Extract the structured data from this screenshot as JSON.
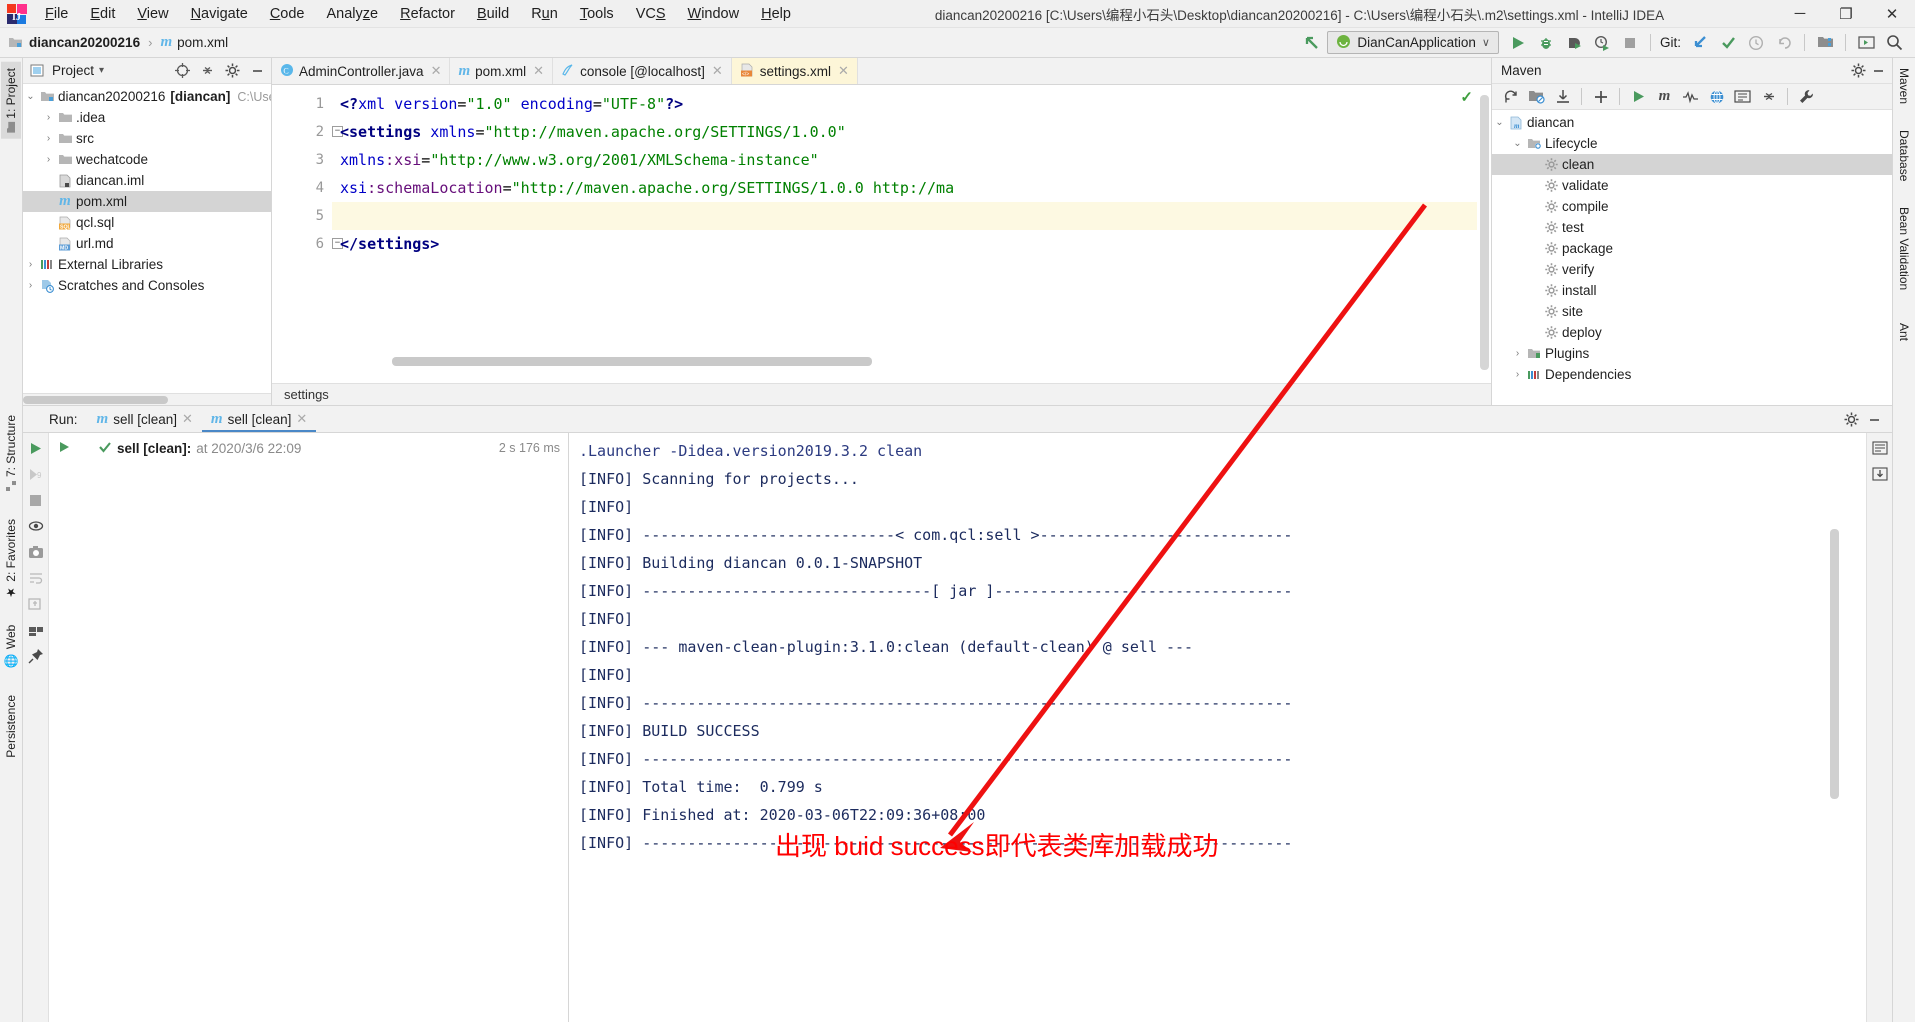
{
  "window": {
    "title": "diancan20200216 [C:\\Users\\编程小石头\\Desktop\\diancan20200216] - C:\\Users\\编程小石头\\.m2\\settings.xml - IntelliJ IDEA",
    "minimize_label": "─",
    "maximize_label": "❐",
    "close_label": "✕",
    "app_icon": "intellij-idea-logo"
  },
  "menubar": {
    "items": [
      {
        "label": "File"
      },
      {
        "label": "Edit"
      },
      {
        "label": "View"
      },
      {
        "label": "Navigate"
      },
      {
        "label": "Code"
      },
      {
        "label": "Analyze"
      },
      {
        "label": "Refactor"
      },
      {
        "label": "Build"
      },
      {
        "label": "Run"
      },
      {
        "label": "Tools"
      },
      {
        "label": "VCS"
      },
      {
        "label": "Window"
      },
      {
        "label": "Help"
      }
    ]
  },
  "navbar": {
    "breadcrumb": {
      "project": "diancan20200216",
      "separator": "›",
      "file": "pom.xml",
      "file_icon": "maven-m-icon",
      "project_icon": "module-folder-icon"
    },
    "run_config": {
      "name": "DianCanApplication",
      "icon": "spring-boot-icon",
      "chevron": "∨"
    },
    "back_arrow_icon": "back-arrow-icon",
    "buttons": [
      {
        "name": "run-button",
        "icon": "play-icon"
      },
      {
        "name": "debug-button",
        "icon": "bug-icon"
      },
      {
        "name": "run-coverage-button",
        "icon": "coverage-icon"
      },
      {
        "name": "profile-button",
        "icon": "profiler-icon"
      },
      {
        "name": "stop-button",
        "icon": "stop-square-icon"
      }
    ],
    "git_label": "Git:",
    "git_buttons": [
      {
        "name": "update-project-button",
        "icon": "update-arrow-icon"
      },
      {
        "name": "commit-button",
        "icon": "check-icon"
      },
      {
        "name": "history-button",
        "icon": "clock-icon"
      },
      {
        "name": "rollback-button",
        "icon": "undo-icon"
      }
    ],
    "right_buttons": [
      {
        "name": "project-structure-button",
        "icon": "project-structure-icon"
      },
      {
        "name": "select-in-button",
        "icon": "terminal-window-icon"
      },
      {
        "name": "search-everywhere-button",
        "icon": "search-icon"
      }
    ]
  },
  "left_strip": {
    "tabs": [
      {
        "label": "1: Project",
        "icon": "project-icon",
        "selected": true
      },
      {
        "label": "7: Structure",
        "icon": "structure-icon",
        "selected": false
      },
      {
        "label": "2: Favorites",
        "icon": "star-icon",
        "selected": false
      },
      {
        "label": "Web",
        "icon": "web-globe-icon",
        "selected": false
      },
      {
        "label": "Persistence",
        "icon": "persistence-icon",
        "selected": false
      }
    ]
  },
  "right_strip": {
    "tabs": [
      {
        "label": "Maven",
        "icon": "maven-icon"
      },
      {
        "label": "Database",
        "icon": "database-icon"
      },
      {
        "label": "Bean Validation",
        "icon": "bean-icon"
      },
      {
        "label": "Ant",
        "icon": "ant-icon"
      }
    ]
  },
  "project_panel": {
    "title": "Project",
    "title_chevron": "▾",
    "view_icon": "project-view-icon",
    "toolbar": [
      {
        "name": "locate-button",
        "icon": "crosshair-icon"
      },
      {
        "name": "collapse-all-button",
        "icon": "collapse-all-icon"
      },
      {
        "name": "settings-button",
        "icon": "gear-icon"
      },
      {
        "name": "hide-button",
        "icon": "minimize-icon"
      }
    ],
    "tree": [
      {
        "indent": 0,
        "twist": "⌄",
        "icon": "module-folder-icon",
        "label": "diancan20200216",
        "bold_label": "[diancan]",
        "path": "C:\\Use",
        "selected": false
      },
      {
        "indent": 1,
        "twist": "›",
        "icon": "folder-icon",
        "label": ".idea",
        "selected": false
      },
      {
        "indent": 1,
        "twist": "›",
        "icon": "folder-icon",
        "label": "src",
        "selected": false
      },
      {
        "indent": 1,
        "twist": "›",
        "icon": "folder-icon",
        "label": "wechatcode",
        "selected": false
      },
      {
        "indent": 1,
        "twist": "",
        "icon": "iml-file-icon",
        "label": "diancan.iml",
        "selected": false
      },
      {
        "indent": 1,
        "twist": "",
        "icon": "maven-m-icon",
        "label": "pom.xml",
        "selected": true
      },
      {
        "indent": 1,
        "twist": "",
        "icon": "sql-file-icon",
        "label": "qcl.sql",
        "selected": false
      },
      {
        "indent": 1,
        "twist": "",
        "icon": "md-file-icon",
        "label": "url.md",
        "selected": false
      },
      {
        "indent": 0,
        "twist": "›",
        "icon": "libraries-icon",
        "label": "External Libraries",
        "selected": false
      },
      {
        "indent": 0,
        "twist": "›",
        "icon": "scratches-icon",
        "label": "Scratches and Consoles",
        "selected": false
      }
    ]
  },
  "editor": {
    "tabs": [
      {
        "label": "AdminController.java",
        "icon": "java-class-icon",
        "active": false,
        "close": "✕"
      },
      {
        "label": "pom.xml",
        "icon": "maven-m-icon",
        "active": false,
        "close": "✕"
      },
      {
        "label": "console [@localhost]",
        "icon": "console-icon",
        "active": false,
        "close": "✕"
      },
      {
        "label": "settings.xml",
        "icon": "xml-file-icon",
        "active": true,
        "close": "✕"
      }
    ],
    "line_numbers": [
      "1",
      "2",
      "3",
      "4",
      "5",
      "6"
    ],
    "lines": [
      {
        "n": "1",
        "fold": "",
        "highlight": false,
        "tokens": [
          {
            "t": "<?",
            "c": "tk-tag"
          },
          {
            "t": "xml",
            "c": "tk-attr"
          },
          {
            "t": " version",
            "c": "tk-attr"
          },
          {
            "t": "=",
            "c": "tk-punc"
          },
          {
            "t": "\"1.0\"",
            "c": "tk-val"
          },
          {
            "t": " encoding",
            "c": "tk-attr"
          },
          {
            "t": "=",
            "c": "tk-punc"
          },
          {
            "t": "\"UTF-8\"",
            "c": "tk-val"
          },
          {
            "t": "?>",
            "c": "tk-tag"
          }
        ]
      },
      {
        "n": "2",
        "fold": "−",
        "highlight": false,
        "tokens": [
          {
            "t": "<settings",
            "c": "tk-tag"
          },
          {
            "t": " xmlns",
            "c": "tk-attr"
          },
          {
            "t": "=",
            "c": "tk-punc"
          },
          {
            "t": "\"http://maven.apache.org/SETTINGS/1.0.0\"",
            "c": "tk-val"
          }
        ]
      },
      {
        "n": "3",
        "fold": "",
        "highlight": false,
        "tokens": [
          {
            "t": "          xmlns",
            "c": "tk-attr"
          },
          {
            "t": ":xsi",
            "c": "tk-attr2"
          },
          {
            "t": "=",
            "c": "tk-punc"
          },
          {
            "t": "\"http://www.w3.org/2001/XMLSchema-instance\"",
            "c": "tk-val"
          }
        ]
      },
      {
        "n": "4",
        "fold": "",
        "highlight": false,
        "tokens": [
          {
            "t": "          xsi",
            "c": "tk-attr"
          },
          {
            "t": ":schemaLocation",
            "c": "tk-attr2"
          },
          {
            "t": "=",
            "c": "tk-punc"
          },
          {
            "t": "\"http://maven.apache.org/SETTINGS/1.0.0 http://ma",
            "c": "tk-val"
          }
        ]
      },
      {
        "n": "5",
        "fold": "",
        "highlight": true,
        "tokens": []
      },
      {
        "n": "6",
        "fold": "−",
        "highlight": false,
        "tokens": [
          {
            "t": "</settings>",
            "c": "tk-tag"
          }
        ]
      }
    ],
    "inspection_ok_icon": "inspection-check-icon",
    "breadcrumb": "settings"
  },
  "maven_panel": {
    "title": "Maven",
    "header_buttons": [
      {
        "name": "maven-settings-button",
        "icon": "gear-icon"
      },
      {
        "name": "maven-hide-button",
        "icon": "minimize-icon"
      }
    ],
    "toolbar": [
      {
        "name": "reimport-button",
        "icon": "refresh-icon"
      },
      {
        "name": "generate-sources-button",
        "icon": "generate-sources-icon"
      },
      {
        "name": "download-sources-button",
        "icon": "download-icon"
      },
      {
        "name": "add-maven-project-button",
        "icon": "plus-icon"
      },
      {
        "name": "run-maven-build-button",
        "icon": "play-icon"
      },
      {
        "name": "execute-maven-goal-button",
        "icon": "maven-m-icon"
      },
      {
        "name": "toggle-skip-tests-button",
        "icon": "skip-tests-icon"
      },
      {
        "name": "toggle-offline-button",
        "icon": "offline-icon"
      },
      {
        "name": "show-dependencies-button",
        "icon": "dependencies-diagram-icon"
      },
      {
        "name": "collapse-all-button",
        "icon": "collapse-all-icon"
      },
      {
        "name": "maven-settings-wrench-button",
        "icon": "wrench-icon"
      }
    ],
    "tree": [
      {
        "indent": 0,
        "twist": "⌄",
        "icon": "maven-project-icon",
        "label": "diancan",
        "selected": false
      },
      {
        "indent": 1,
        "twist": "⌄",
        "icon": "lifecycle-folder-icon",
        "label": "Lifecycle",
        "selected": false
      },
      {
        "indent": 2,
        "twist": "",
        "icon": "goal-gear-icon",
        "label": "clean",
        "selected": true
      },
      {
        "indent": 2,
        "twist": "",
        "icon": "goal-gear-icon",
        "label": "validate",
        "selected": false
      },
      {
        "indent": 2,
        "twist": "",
        "icon": "goal-gear-icon",
        "label": "compile",
        "selected": false
      },
      {
        "indent": 2,
        "twist": "",
        "icon": "goal-gear-icon",
        "label": "test",
        "selected": false
      },
      {
        "indent": 2,
        "twist": "",
        "icon": "goal-gear-icon",
        "label": "package",
        "selected": false
      },
      {
        "indent": 2,
        "twist": "",
        "icon": "goal-gear-icon",
        "label": "verify",
        "selected": false
      },
      {
        "indent": 2,
        "twist": "",
        "icon": "goal-gear-icon",
        "label": "install",
        "selected": false
      },
      {
        "indent": 2,
        "twist": "",
        "icon": "goal-gear-icon",
        "label": "site",
        "selected": false
      },
      {
        "indent": 2,
        "twist": "",
        "icon": "goal-gear-icon",
        "label": "deploy",
        "selected": false
      },
      {
        "indent": 1,
        "twist": "›",
        "icon": "plugins-folder-icon",
        "label": "Plugins",
        "selected": false
      },
      {
        "indent": 1,
        "twist": "›",
        "icon": "dependencies-folder-icon",
        "label": "Dependencies",
        "selected": false
      }
    ]
  },
  "run_panel": {
    "label": "Run:",
    "tabs": [
      {
        "label": "sell [clean]",
        "icon": "maven-m-icon",
        "active": false,
        "close": "✕"
      },
      {
        "label": "sell [clean]",
        "icon": "maven-m-icon",
        "active": true,
        "close": "✕"
      }
    ],
    "header_buttons": [
      {
        "name": "run-settings-button",
        "icon": "gear-icon"
      },
      {
        "name": "run-hide-button",
        "icon": "minimize-icon"
      }
    ],
    "sidebar_buttons": [
      {
        "name": "rerun-button",
        "icon": "play-icon"
      },
      {
        "name": "rerun-failed-tests-button",
        "icon": "rerun-failed-icon"
      },
      {
        "name": "stop-button",
        "icon": "stop-square-icon"
      },
      {
        "name": "toggle-auto-test-button",
        "icon": "eye-icon"
      },
      {
        "name": "export-test-results-button",
        "icon": "camera-icon"
      },
      {
        "name": "toggle-soft-wrap-button",
        "icon": "soft-wrap-icon"
      },
      {
        "name": "scroll-to-end-button",
        "icon": "scroll-end-icon"
      },
      {
        "name": "print-button",
        "icon": "print-icon"
      },
      {
        "name": "pin-tab-button",
        "icon": "pin-icon"
      }
    ],
    "right_buttons": [
      {
        "name": "collapse-console-button",
        "icon": "wrap-lines-icon"
      },
      {
        "name": "scroll-to-end-console-button",
        "icon": "scroll-down-icon"
      }
    ],
    "tree_row": {
      "status_icon": "success-check-icon",
      "name": "sell [clean]:",
      "detail": "at 2020/3/6 22:09",
      "duration": "2 s 176 ms",
      "run_icon": "play-icon"
    },
    "console_lines": [
      ".Launcher -Didea.version2019.3.2 clean",
      "[INFO] Scanning for projects...",
      "[INFO]",
      "[INFO] ----------------------------< com.qcl:sell >----------------------------",
      "[INFO] Building diancan 0.0.1-SNAPSHOT",
      "[INFO] --------------------------------[ jar ]---------------------------------",
      "[INFO]",
      "[INFO] --- maven-clean-plugin:3.1.0:clean (default-clean) @ sell ---",
      "[INFO]",
      "[INFO] ------------------------------------------------------------------------",
      "[INFO] BUILD SUCCESS",
      "[INFO] ------------------------------------------------------------------------",
      "[INFO] Total time:  0.799 s",
      "[INFO] Finished at: 2020-03-06T22:09:36+08:00",
      "[INFO] ------------------------------------------------------------------------"
    ]
  },
  "annotation": {
    "text": "出现 buid success即代表类库加载成功",
    "color": "#ff0000",
    "arrow_name": "red-annotation-arrow"
  }
}
